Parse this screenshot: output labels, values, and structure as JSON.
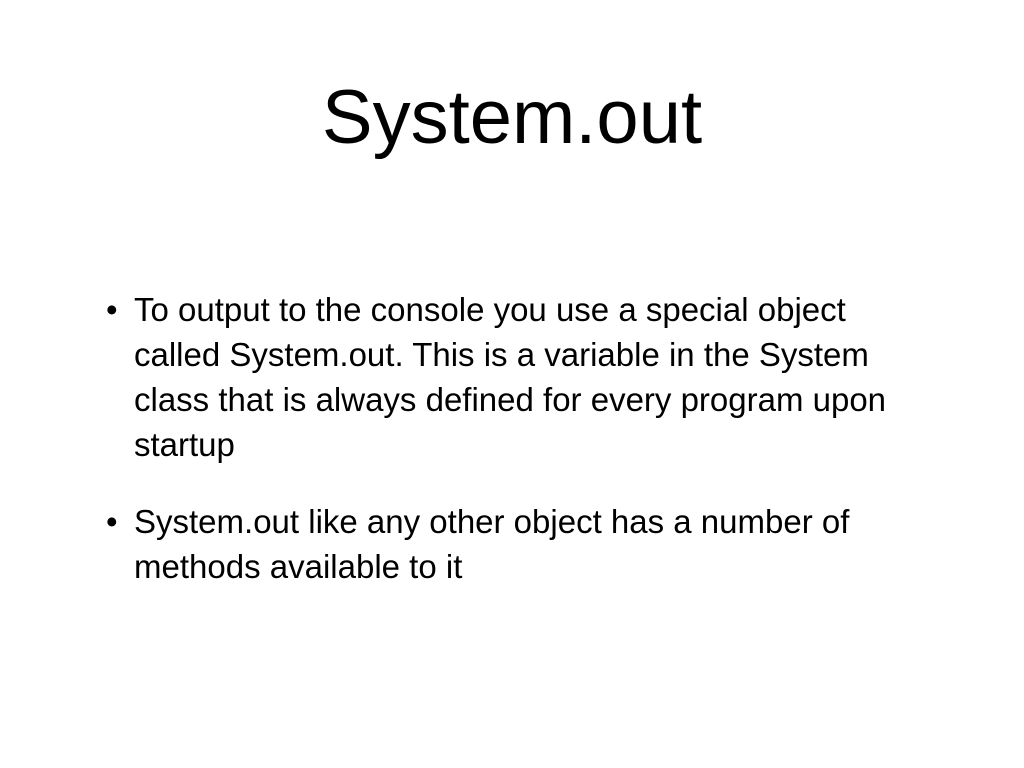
{
  "slide": {
    "title": "System.out",
    "bullets": [
      {
        "text": "To output to the console you use a special object called System.out. This is a variable in the System class that is always defined for every program upon startup"
      },
      {
        "text": "System.out like any other object has a number of methods available to it"
      }
    ],
    "bullet_glyph": "•"
  }
}
